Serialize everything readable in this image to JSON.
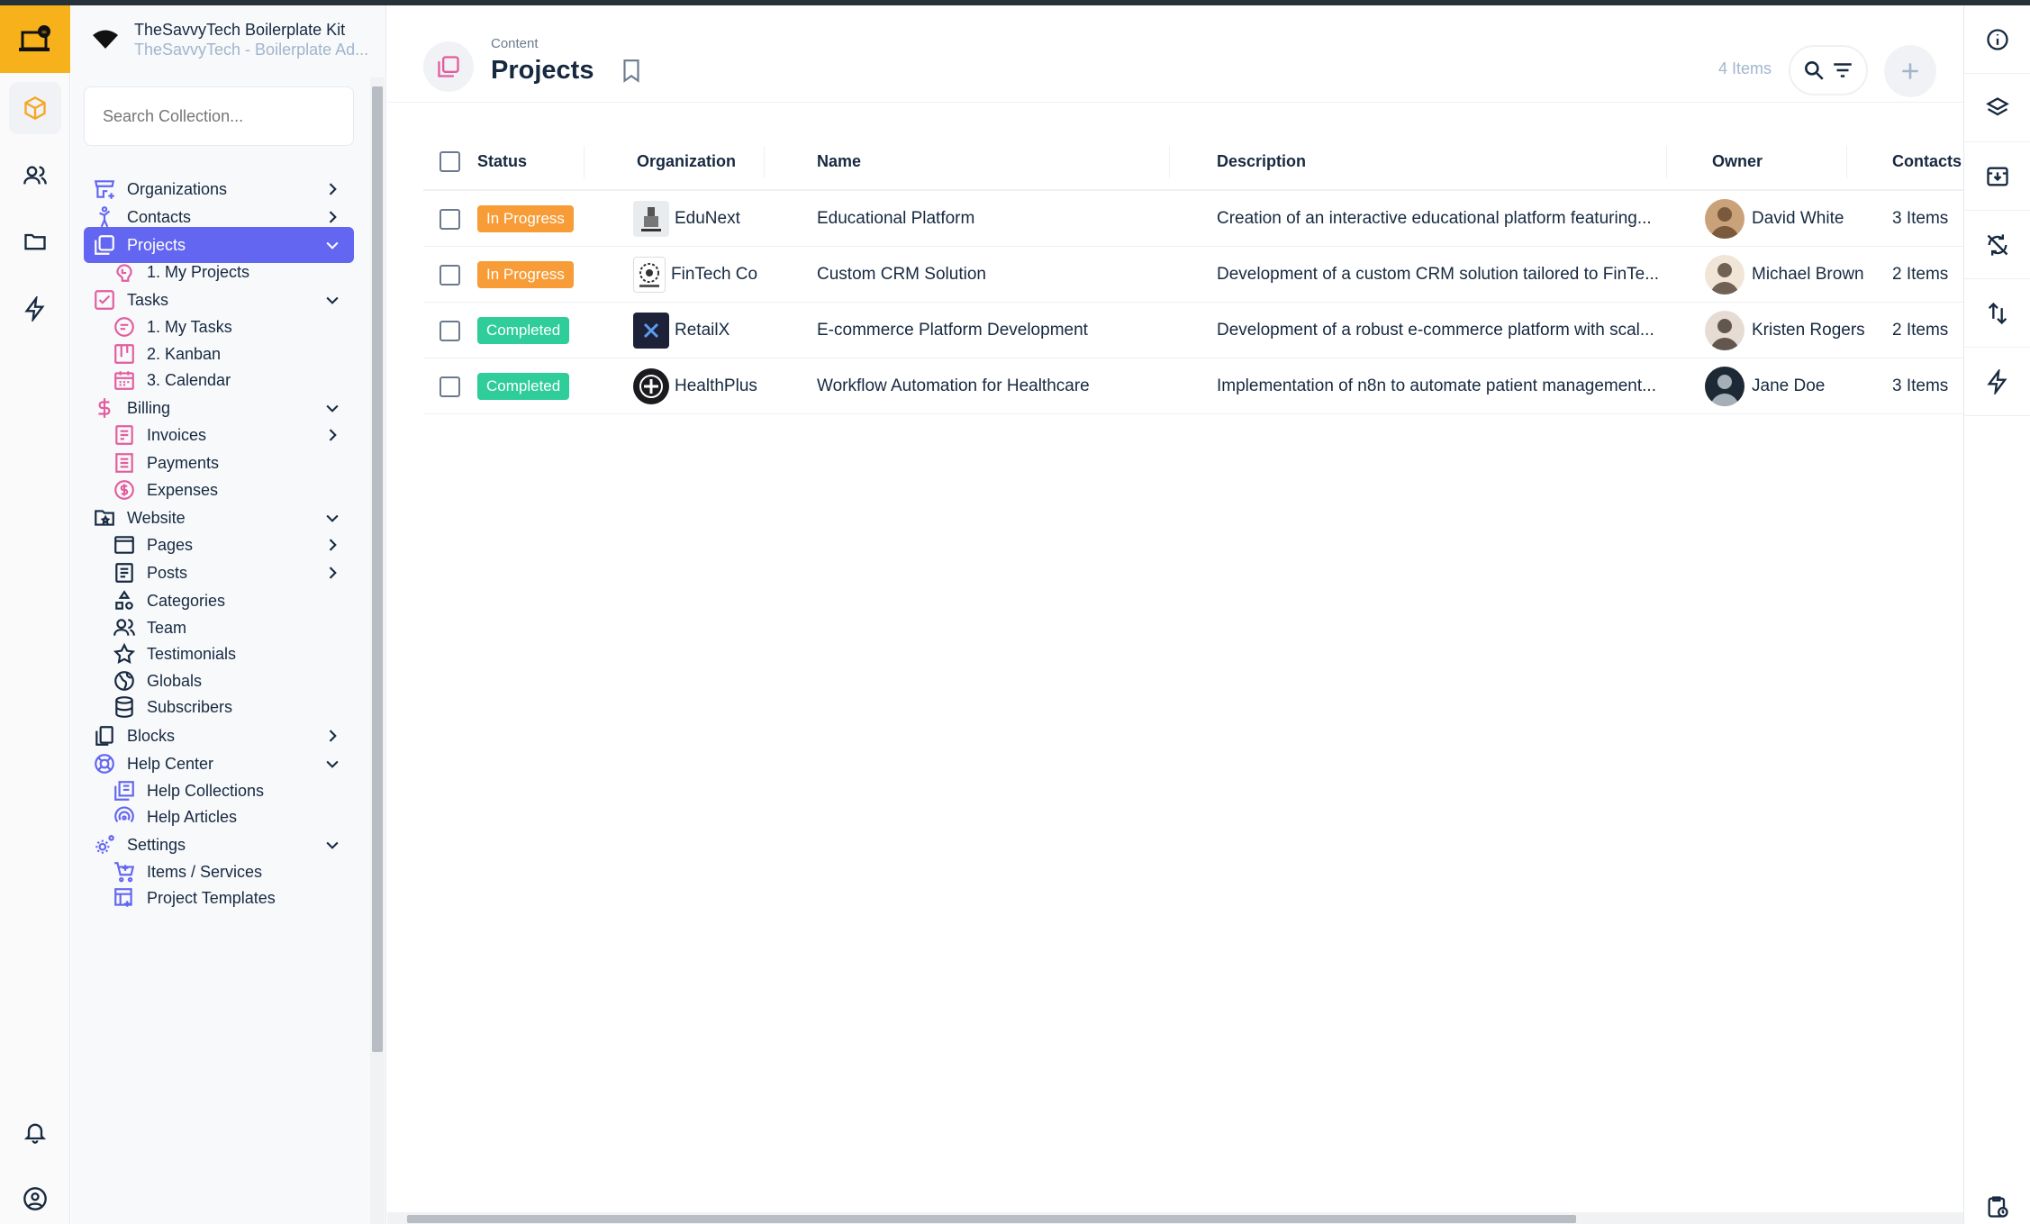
{
  "project": {
    "name": "TheSavvyTech Boilerplate Kit",
    "description": "TheSavvyTech - Boilerplate Ad..."
  },
  "nav": {
    "search_placeholder": "Search Collection...",
    "items": [
      {
        "label": "Organizations",
        "icon": "organization-icon"
      },
      {
        "label": "Contacts",
        "icon": "person-icon"
      },
      {
        "label": "Projects",
        "icon": "projects-icon"
      },
      {
        "label": "1. My Projects",
        "icon": "my-projects-icon"
      },
      {
        "label": "Tasks",
        "icon": "tasks-icon"
      },
      {
        "label": "1. My Tasks",
        "icon": "my-tasks-icon"
      },
      {
        "label": "2. Kanban",
        "icon": "kanban-icon"
      },
      {
        "label": "3. Calendar",
        "icon": "calendar-icon"
      },
      {
        "label": "Billing",
        "icon": "dollar-icon"
      },
      {
        "label": "Invoices",
        "icon": "invoice-icon"
      },
      {
        "label": "Payments",
        "icon": "payments-icon"
      },
      {
        "label": "Expenses",
        "icon": "expenses-icon"
      },
      {
        "label": "Website",
        "icon": "website-folder-icon"
      },
      {
        "label": "Pages",
        "icon": "pages-icon"
      },
      {
        "label": "Posts",
        "icon": "posts-icon"
      },
      {
        "label": "Categories",
        "icon": "categories-icon"
      },
      {
        "label": "Team",
        "icon": "team-icon"
      },
      {
        "label": "Testimonials",
        "icon": "star-icon"
      },
      {
        "label": "Globals",
        "icon": "globe-icon"
      },
      {
        "label": "Subscribers",
        "icon": "database-icon"
      },
      {
        "label": "Blocks",
        "icon": "blocks-icon"
      },
      {
        "label": "Help Center",
        "icon": "help-icon"
      },
      {
        "label": "Help Collections",
        "icon": "help-collections-icon"
      },
      {
        "label": "Help Articles",
        "icon": "help-articles-icon"
      },
      {
        "label": "Settings",
        "icon": "settings-icon"
      },
      {
        "label": "Items / Services",
        "icon": "cart-icon"
      },
      {
        "label": "Project Templates",
        "icon": "template-icon"
      }
    ]
  },
  "header": {
    "breadcrumb": "Content",
    "title": "Projects",
    "count": "4 Items"
  },
  "table": {
    "columns": [
      "Status",
      "Organization",
      "Name",
      "Description",
      "Owner",
      "Contacts"
    ],
    "rows": [
      {
        "status": "In Progress",
        "organization": "EduNext",
        "name": "Educational Platform",
        "description": "Creation of an interactive educational platform featuring...",
        "owner": "David White",
        "contacts": "3 Items"
      },
      {
        "status": "In Progress",
        "organization": "FinTech Co...",
        "name": "Custom CRM Solution",
        "description": "Development of a custom CRM solution tailored to FinTe...",
        "owner": "Michael Brown",
        "contacts": "2 Items"
      },
      {
        "status": "Completed",
        "organization": "RetailX",
        "name": "E-commerce Platform Development",
        "description": "Development of a robust e-commerce platform with scal...",
        "owner": "Kristen Rogers",
        "contacts": "2 Items"
      },
      {
        "status": "Completed",
        "organization": "HealthPlus",
        "name": "Workflow Automation for Healthcare",
        "description": "Implementation of n8n to automate patient management...",
        "owner": "Jane Doe",
        "contacts": "3 Items"
      }
    ]
  },
  "colors": {
    "accent": "#6366f1",
    "in_progress": "#f79c36",
    "completed": "#2ecd99",
    "logo_bg": "#f7b21b",
    "nav_icon": "#e35d9e"
  }
}
